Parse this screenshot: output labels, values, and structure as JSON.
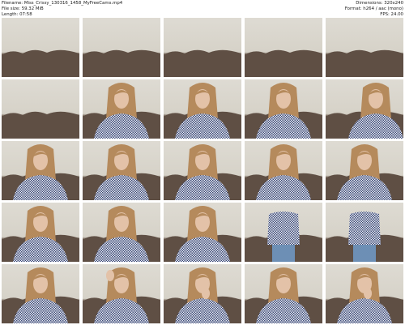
{
  "header": {
    "filename": "Filename: Miss_Crissy_130316_1458_MyFreeCams.mp4",
    "filesize": "File size: 59.32 MiB",
    "length": "Length: 07:58",
    "dimensions": "Dimensions: 320x240",
    "format": "Format: h264 / aac (mono)",
    "fps": "FPS: 24.00"
  },
  "thumbnails": [
    {
      "kind": "empty"
    },
    {
      "kind": "empty"
    },
    {
      "kind": "empty"
    },
    {
      "kind": "empty"
    },
    {
      "kind": "empty"
    },
    {
      "kind": "empty"
    },
    {
      "kind": "person"
    },
    {
      "kind": "person"
    },
    {
      "kind": "person"
    },
    {
      "kind": "person-right"
    },
    {
      "kind": "person"
    },
    {
      "kind": "person"
    },
    {
      "kind": "person"
    },
    {
      "kind": "person"
    },
    {
      "kind": "person"
    },
    {
      "kind": "person"
    },
    {
      "kind": "person"
    },
    {
      "kind": "person"
    },
    {
      "kind": "standing"
    },
    {
      "kind": "standing"
    },
    {
      "kind": "person"
    },
    {
      "kind": "person-arm"
    },
    {
      "kind": "person-hand"
    },
    {
      "kind": "person"
    },
    {
      "kind": "person-hand"
    }
  ],
  "colors": {
    "wall": "#dedbd3",
    "sofa": "#5f4f44",
    "shirt": "#3d4a78",
    "hair": "#b58a5c",
    "skin": "#e3c2a8",
    "jeans": "#6d8fb5"
  }
}
